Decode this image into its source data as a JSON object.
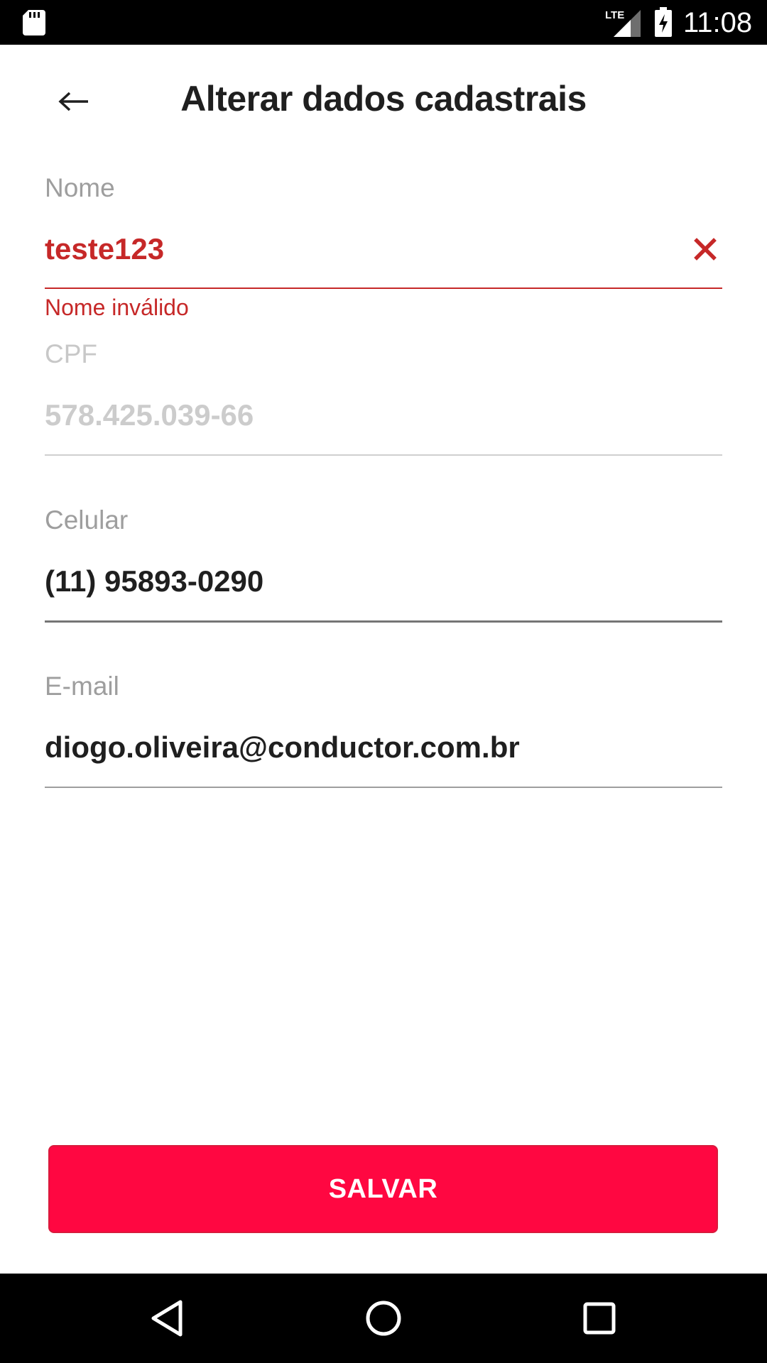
{
  "status_bar": {
    "time": "11:08",
    "network_label": "LTE",
    "icons": [
      "sd-card-icon",
      "lte-signal-icon",
      "battery-charging-icon"
    ]
  },
  "header": {
    "title": "Alterar dados cadastrais",
    "back_icon": "arrow-back-icon"
  },
  "form": {
    "nome": {
      "label": "Nome",
      "value": "teste123",
      "error": "Nome inválido",
      "clear_icon": "close-icon"
    },
    "cpf": {
      "label": "CPF",
      "value": "578.425.039-66"
    },
    "celular": {
      "label": "Celular",
      "value": "(11) 95893-0290"
    },
    "email": {
      "label": "E-mail",
      "value": "diogo.oliveira@conductor.com.br"
    }
  },
  "actions": {
    "save_label": "SALVAR"
  },
  "nav_bar": {
    "icons": [
      "nav-back-icon",
      "nav-home-icon",
      "nav-recents-icon"
    ]
  },
  "colors": {
    "accent": "#ff0741",
    "error": "#c62828",
    "label": "#9e9e9e",
    "text": "#1f1f1f"
  }
}
